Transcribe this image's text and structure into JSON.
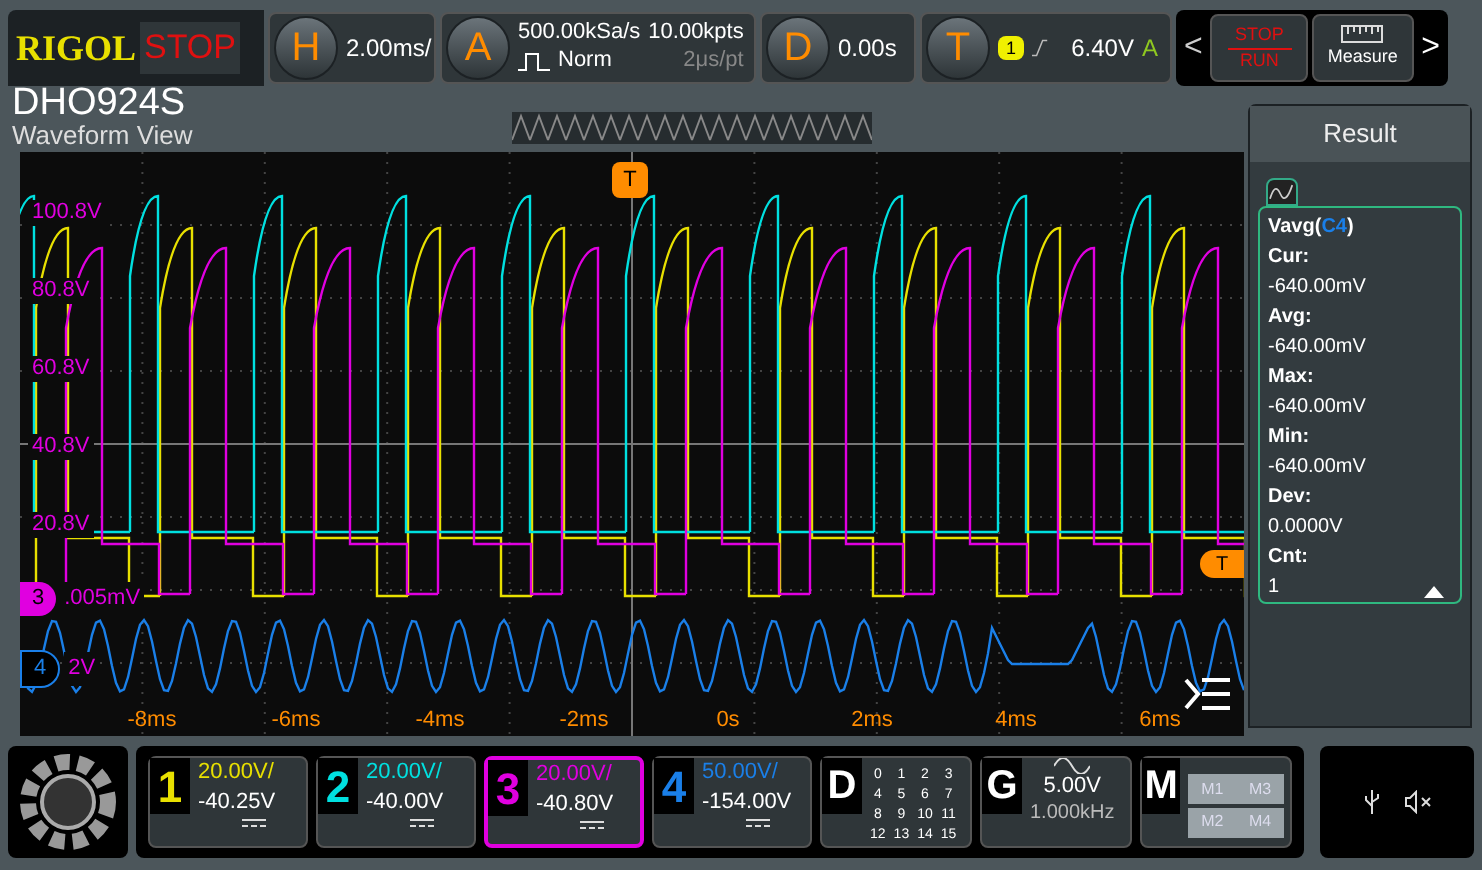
{
  "header": {
    "brand": "RIGOL",
    "run_state": "STOP",
    "horizontal": {
      "letter": "H",
      "value": "2.00ms/"
    },
    "acquire": {
      "letter": "A",
      "sample_rate": "500.00kSa/s",
      "mode": "Norm",
      "memory": "10.00kpts",
      "resolution": "2μs/pt"
    },
    "delay": {
      "letter": "D",
      "value": "0.00s"
    },
    "trigger": {
      "letter": "T",
      "source": "1",
      "level": "6.40V",
      "sweep": "A"
    },
    "controls": {
      "prev": "<",
      "stop": "STOP",
      "run": "RUN",
      "measure": "Measure",
      "next": ">"
    }
  },
  "model": "DHO924S",
  "view_title": "Waveform View",
  "plot": {
    "y_labels": [
      "100.8V",
      "80.8V",
      "60.8V",
      "40.8V",
      "20.8V"
    ],
    "x_labels": [
      "-8ms",
      "-6ms",
      "-4ms",
      "-2ms",
      "0s",
      "2ms",
      "4ms",
      "6ms"
    ],
    "trigger_position": "T",
    "trigger_level": "T",
    "ch3_marker": {
      "label": "3",
      "offset": ".005mV"
    },
    "ch4_marker": {
      "label": "4",
      "offset": "2V"
    }
  },
  "result": {
    "title": "Result",
    "label_prefix": "Vavg(",
    "source": "C4",
    "label_suffix": ")",
    "items": [
      {
        "label": "Cur:",
        "value": "-640.00mV"
      },
      {
        "label": "Avg:",
        "value": "-640.00mV"
      },
      {
        "label": "Max:",
        "value": "-640.00mV"
      },
      {
        "label": "Min:",
        "value": "-640.00mV"
      },
      {
        "label": "Dev:",
        "value": "0.0000V"
      },
      {
        "label": "Cnt:",
        "value": "1"
      }
    ]
  },
  "channels": [
    {
      "number": "1",
      "scale": "20.00V/",
      "offset": "-40.25V",
      "color": "#e8e000",
      "selected": false
    },
    {
      "number": "2",
      "scale": "20.00V/",
      "offset": "-40.00V",
      "color": "#00e0e0",
      "selected": false
    },
    {
      "number": "3",
      "scale": "20.00V/",
      "offset": "-40.80V",
      "color": "#e000e0",
      "selected": true
    },
    {
      "number": "4",
      "scale": "50.00V/",
      "offset": "-154.00V",
      "color": "#1a7fe8",
      "selected": false
    }
  ],
  "digital": {
    "letter": "D",
    "bits": [
      "0",
      "1",
      "2",
      "3",
      "4",
      "5",
      "6",
      "7",
      "8",
      "9",
      "10",
      "11",
      "12",
      "13",
      "14",
      "15"
    ]
  },
  "generator": {
    "letter": "G",
    "amplitude": "5.00V",
    "frequency": "1.000kHz"
  },
  "math": {
    "letter": "M",
    "items": [
      "M1",
      "M3",
      "M2",
      "M4"
    ]
  }
}
